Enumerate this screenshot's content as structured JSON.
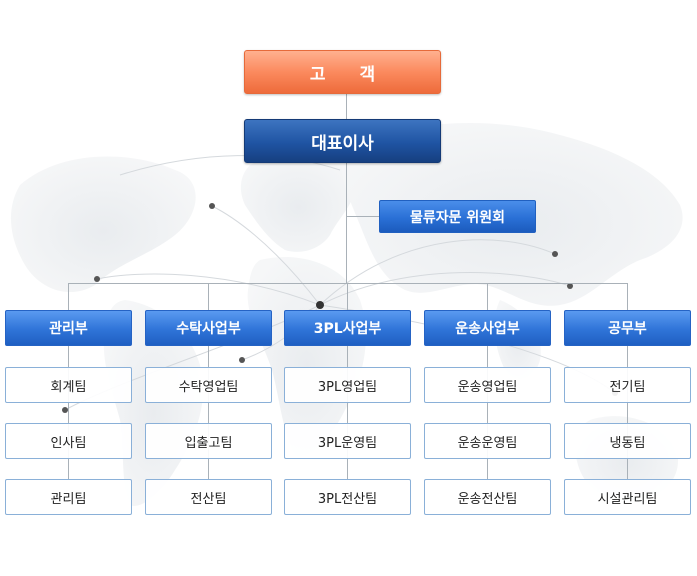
{
  "org": {
    "customer": "고 객",
    "ceo": "대표이사",
    "advisory": "물류자문 위원회",
    "departments": [
      {
        "name": "관리부",
        "teams": [
          "회계팀",
          "인사팀",
          "관리팀"
        ]
      },
      {
        "name": "수탁사업부",
        "teams": [
          "수탁영업팀",
          "입출고팀",
          "전산팀"
        ]
      },
      {
        "name": "3PL사업부",
        "teams": [
          "3PL영업팀",
          "3PL운영팀",
          "3PL전산팀"
        ]
      },
      {
        "name": "운송사업부",
        "teams": [
          "운송영업팀",
          "운송운영팀",
          "운송전산팀"
        ]
      },
      {
        "name": "공무부",
        "teams": [
          "전기팀",
          "냉동팀",
          "시설관리팀"
        ]
      }
    ]
  },
  "colors": {
    "customer": "#f6875a",
    "ceo": "#1f54a3",
    "advisory": "#2a70d6",
    "department": "#2f74d8",
    "team_border": "#8ab0d8",
    "connector": "#a9b1b8"
  }
}
